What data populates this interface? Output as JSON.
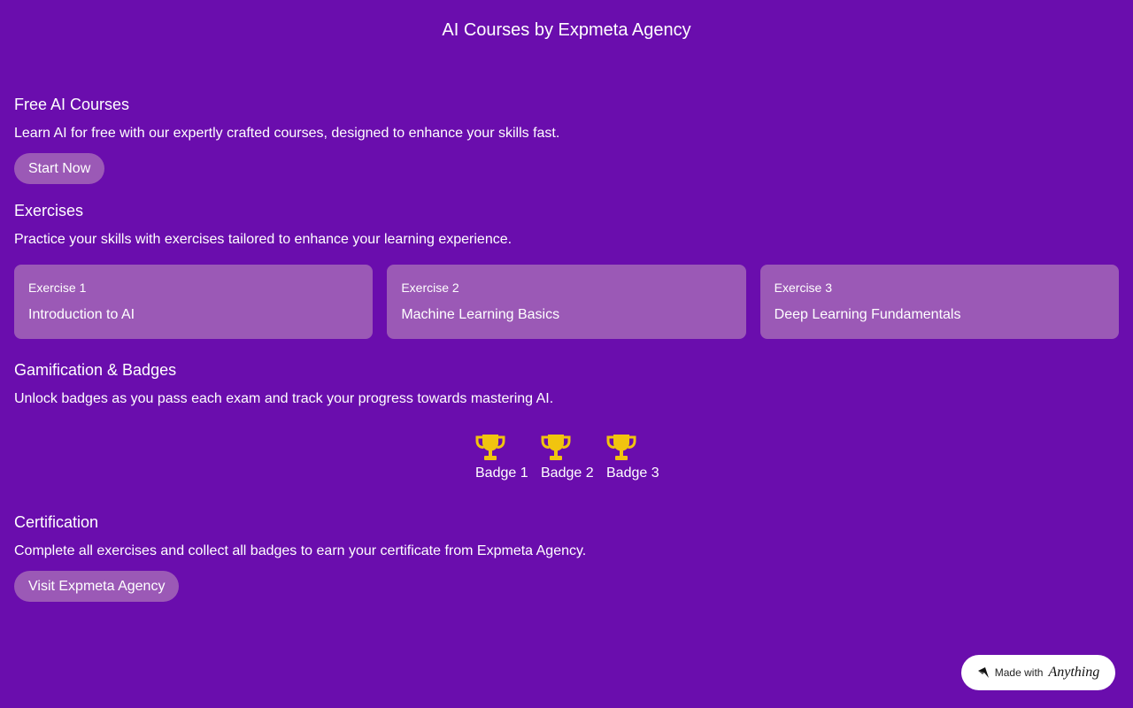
{
  "header": {
    "title": "AI Courses by Expmeta Agency"
  },
  "courses": {
    "heading": "Free AI Courses",
    "description": "Learn AI for free with our expertly crafted courses, designed to enhance your skills fast.",
    "button_label": "Start Now"
  },
  "exercises": {
    "heading": "Exercises",
    "description": "Practice your skills with exercises tailored to enhance your learning experience.",
    "items": [
      {
        "number": "Exercise 1",
        "title": "Introduction to AI"
      },
      {
        "number": "Exercise 2",
        "title": "Machine Learning Basics"
      },
      {
        "number": "Exercise 3",
        "title": "Deep Learning Fundamentals"
      }
    ]
  },
  "badges": {
    "heading": "Gamification & Badges",
    "description": "Unlock badges as you pass each exam and track your progress towards mastering AI.",
    "items": [
      {
        "label": "Badge 1",
        "icon": "trophy-icon"
      },
      {
        "label": "Badge 2",
        "icon": "trophy-icon"
      },
      {
        "label": "Badge 3",
        "icon": "trophy-icon"
      }
    ]
  },
  "certification": {
    "heading": "Certification",
    "description": "Complete all exercises and collect all badges to earn your certificate from Expmeta Agency.",
    "button_label": "Visit Expmeta Agency"
  },
  "footer_badge": {
    "prefix": "Made with",
    "brand": "Anything",
    "icon": "anything-logo-icon"
  },
  "colors": {
    "background": "#6a0dad",
    "card": "#9b59b6",
    "trophy": "#f1c40f",
    "text": "#ffffff"
  }
}
